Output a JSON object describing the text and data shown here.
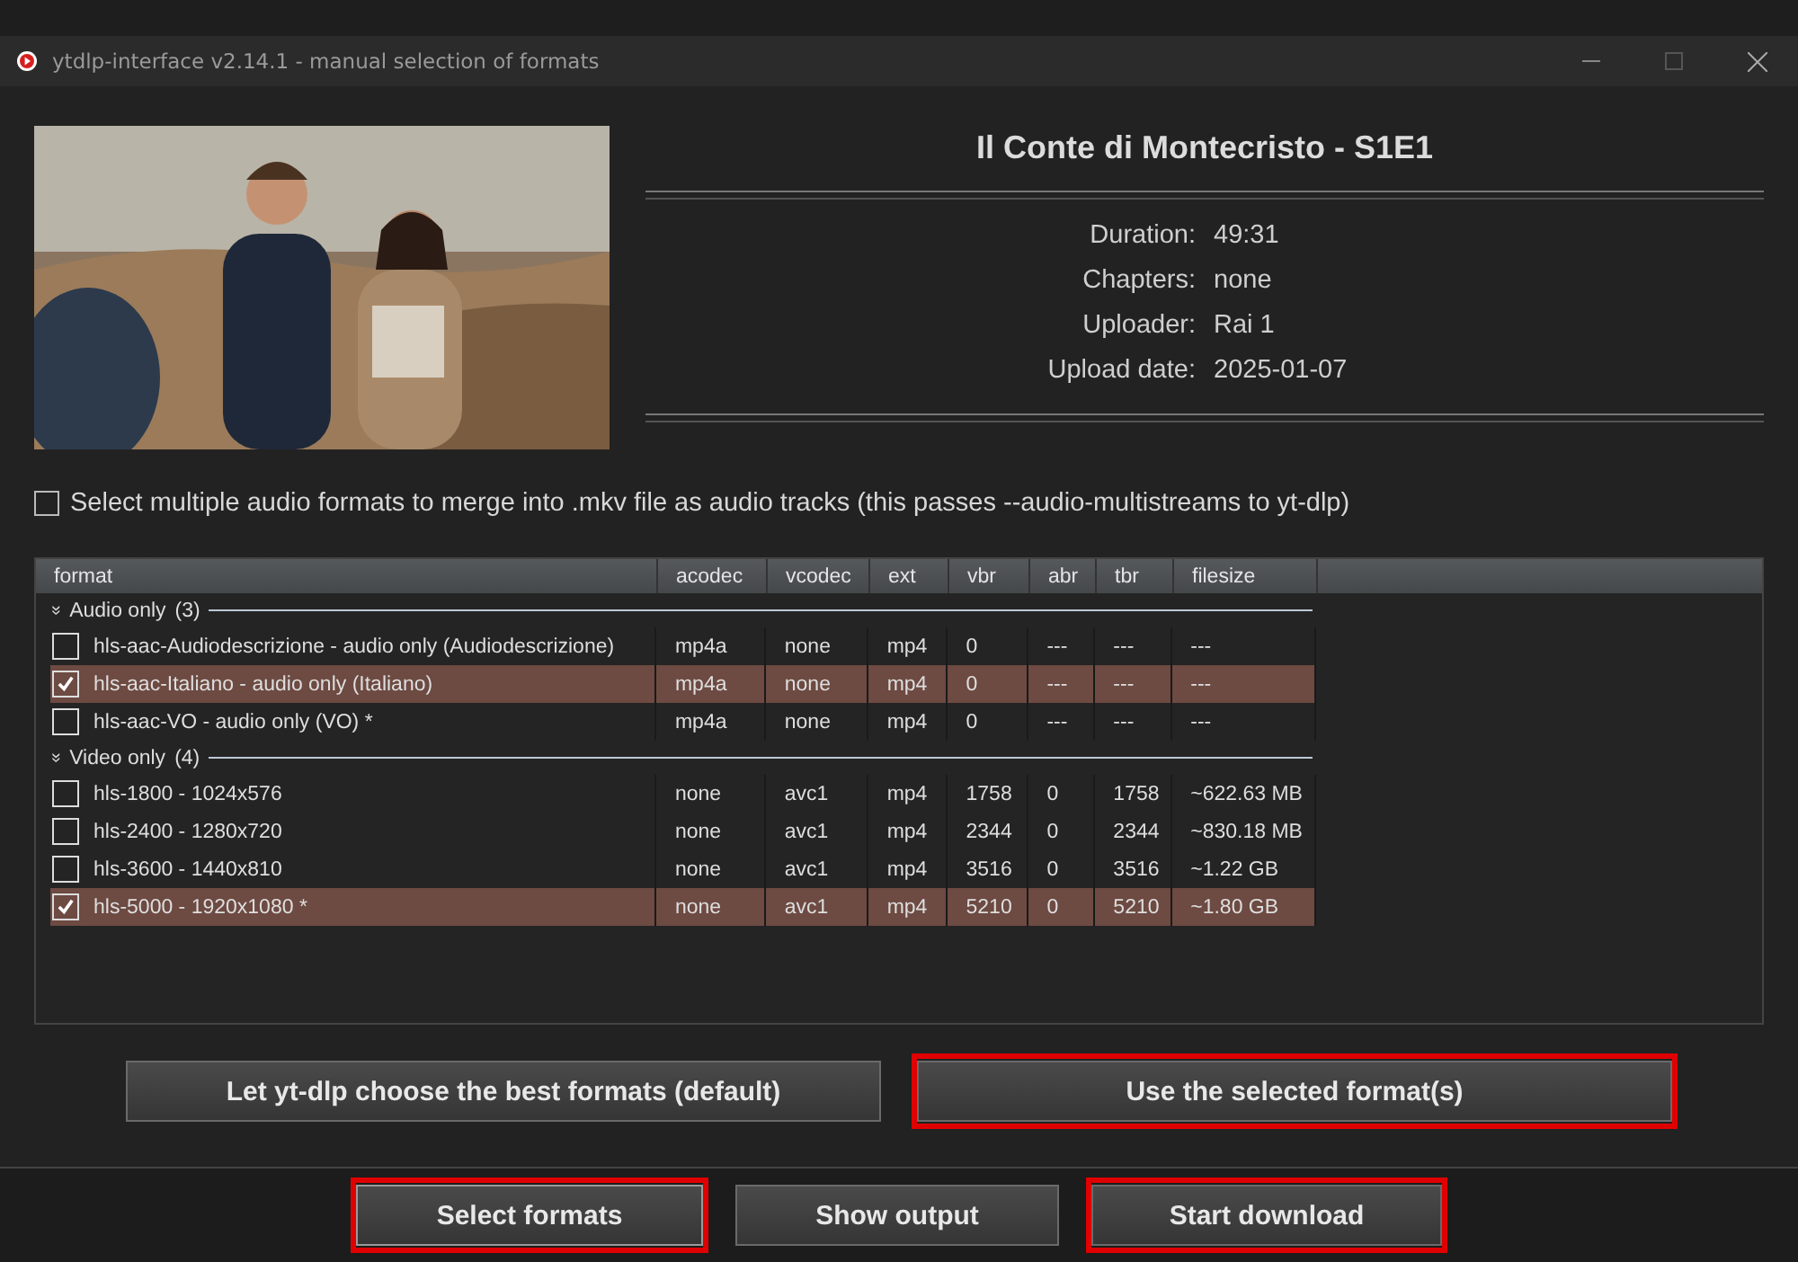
{
  "window": {
    "title": "ytdlp-interface v2.14.1 - manual selection of formats"
  },
  "video": {
    "kind": "picture",
    "title": "Il Conte di Montecristo - S1E1",
    "info": [
      {
        "label": "Duration:",
        "value": "49:31"
      },
      {
        "label": "Chapters:",
        "value": "none"
      },
      {
        "label": "Uploader:",
        "value": "Rai 1"
      },
      {
        "label": "Upload date:",
        "value": "2025-01-07"
      }
    ]
  },
  "multistream_option": {
    "label": "Select multiple audio formats to merge into .mkv file as audio tracks (this passes --audio-multistreams to yt-dlp)",
    "checked": false
  },
  "table": {
    "columns": [
      "format",
      "acodec",
      "vcodec",
      "ext",
      "vbr",
      "abr",
      "tbr",
      "filesize"
    ],
    "groups": [
      {
        "expander": "»",
        "label": "Audio only",
        "count": "(3)",
        "rows": [
          {
            "cells": [
              "hls-aac-Audiodescrizione - audio only (Audiodescrizione)",
              "mp4a",
              "none",
              "mp4",
              "0",
              "---",
              "---",
              "---"
            ],
            "checked": false,
            "selected": false
          },
          {
            "cells": [
              "hls-aac-Italiano - audio only (Italiano)",
              "mp4a",
              "none",
              "mp4",
              "0",
              "---",
              "---",
              "---"
            ],
            "checked": true,
            "selected": true
          },
          {
            "cells": [
              "hls-aac-VO - audio only (VO) *",
              "mp4a",
              "none",
              "mp4",
              "0",
              "---",
              "---",
              "---"
            ],
            "checked": false,
            "selected": false
          }
        ]
      },
      {
        "expander": "»",
        "label": "Video only",
        "count": "(4)",
        "rows": [
          {
            "cells": [
              "hls-1800 - 1024x576",
              "none",
              "avc1",
              "mp4",
              "1758",
              "0",
              "1758",
              "~622.63 MB"
            ],
            "checked": false,
            "selected": false
          },
          {
            "cells": [
              "hls-2400 - 1280x720",
              "none",
              "avc1",
              "mp4",
              "2344",
              "0",
              "2344",
              "~830.18 MB"
            ],
            "checked": false,
            "selected": false
          },
          {
            "cells": [
              "hls-3600 - 1440x810",
              "none",
              "avc1",
              "mp4",
              "3516",
              "0",
              "3516",
              "~1.22 GB"
            ],
            "checked": false,
            "selected": false
          },
          {
            "cells": [
              "hls-5000 - 1920x1080 *",
              "none",
              "avc1",
              "mp4",
              "5210",
              "0",
              "5210",
              "~1.80 GB"
            ],
            "checked": true,
            "selected": true
          }
        ]
      }
    ]
  },
  "choice_buttons": [
    {
      "label": "Let yt-dlp choose the best formats (default)",
      "highlighted": false
    },
    {
      "label": "Use the selected format(s)",
      "highlighted": true
    }
  ],
  "bottom_buttons": [
    {
      "label": "Select formats",
      "highlighted": true,
      "selected": true
    },
    {
      "label": "Show output",
      "highlighted": false,
      "selected": false
    },
    {
      "label": "Start download",
      "highlighted": true,
      "selected": false
    }
  ]
}
